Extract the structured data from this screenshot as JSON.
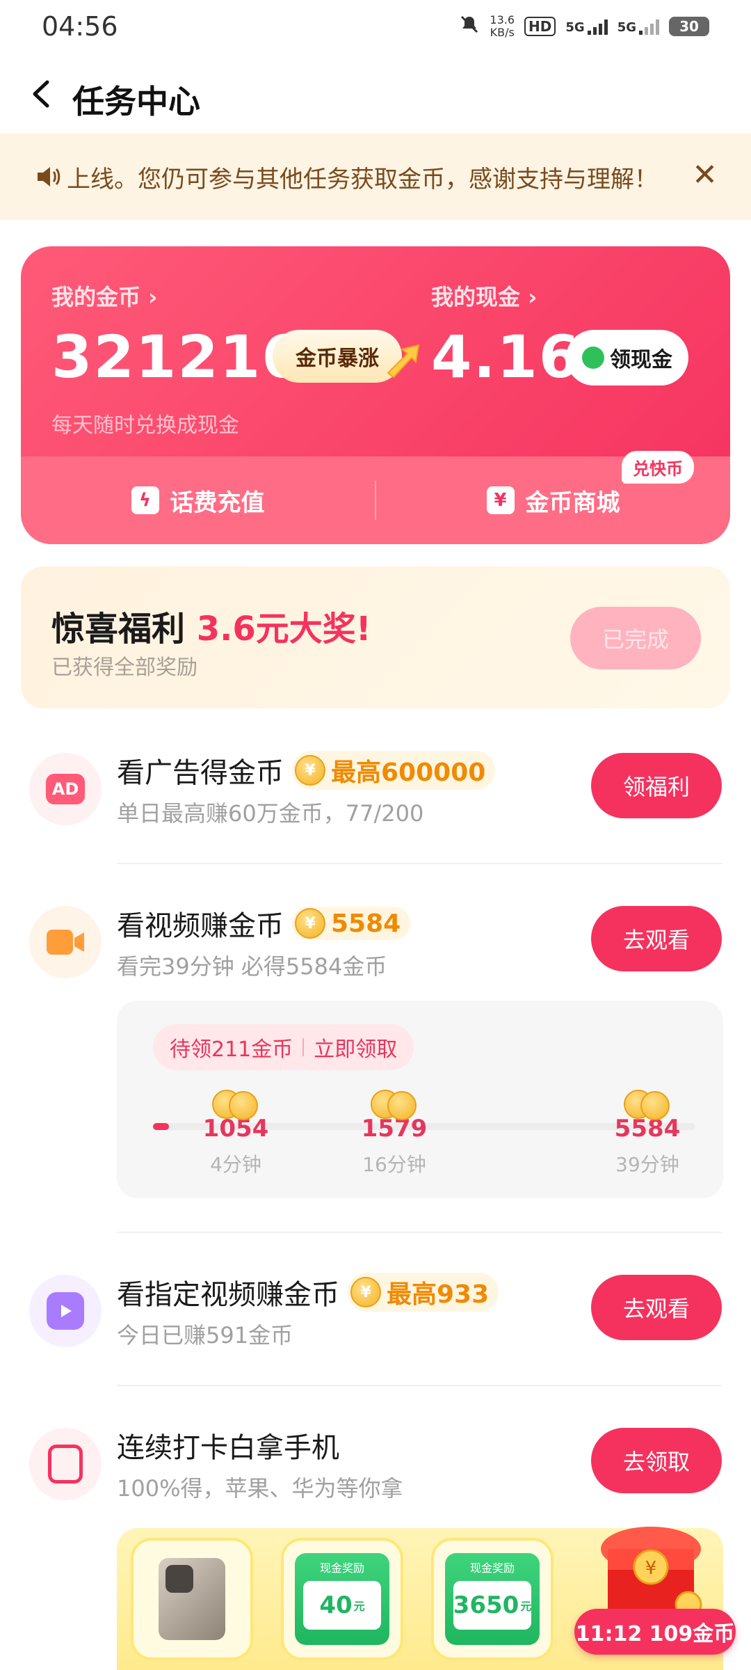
{
  "status_bar": {
    "time": "04:56",
    "net_speed_value": "13.6",
    "net_speed_unit": "KB/s",
    "hd": "HD",
    "sim1": "5G",
    "sim2": "5G",
    "battery": "30"
  },
  "header": {
    "title": "任务中心"
  },
  "notice": {
    "text": "上线。您仍可参与其他任务获取金币，感谢支持与理解！"
  },
  "wallet": {
    "coins_label": "我的金币",
    "coins_value": "321216",
    "coins_sub": "每天随时兑换成现金",
    "surge_label": "金币暴涨",
    "cash_label": "我的现金",
    "cash_value": "4.16",
    "cash_button": "领现金",
    "recharge_label": "话费充值",
    "mall_label": "金币商城",
    "mall_badge": "兑快币"
  },
  "surprise": {
    "title_prefix": "惊喜福利 ",
    "title_highlight": "3.6元大奖!",
    "subtitle": "已获得全部奖励",
    "button": "已完成"
  },
  "tasks": [
    {
      "icon_text": "AD",
      "title": "看广告得金币",
      "reward": "最高600000",
      "subtitle": "单日最高赚60万金币，77/200",
      "button": "领福利"
    },
    {
      "title": "看视频赚金币",
      "reward": "5584",
      "subtitle": "看完39分钟 必得5584金币",
      "button": "去观看"
    },
    {
      "title": "看指定视频赚金币",
      "reward": "最高933",
      "subtitle": "今日已赚591金币",
      "button": "去观看"
    },
    {
      "title": "连续打卡白拿手机",
      "subtitle": "100%得，苹果、华为等你拿",
      "button": "去领取"
    }
  ],
  "video_progress": {
    "pending_text": "待领211金币",
    "claim_text": "立即领取",
    "progress": 0.03,
    "milestones": [
      {
        "amount": "1054",
        "time": "4分钟"
      },
      {
        "amount": "1579",
        "time": "16分钟"
      },
      {
        "amount": "5584",
        "time": "39分钟"
      }
    ]
  },
  "prizes": {
    "cash_label": "现金奖励",
    "cash_1": "40",
    "cash_2": "3650",
    "unit": "元"
  },
  "floating_timer": {
    "text": "11:12 109金币"
  },
  "colors": {
    "accent": "#f5325e",
    "gold": "#f08a00",
    "notice_bg": "#fdf4e3"
  }
}
